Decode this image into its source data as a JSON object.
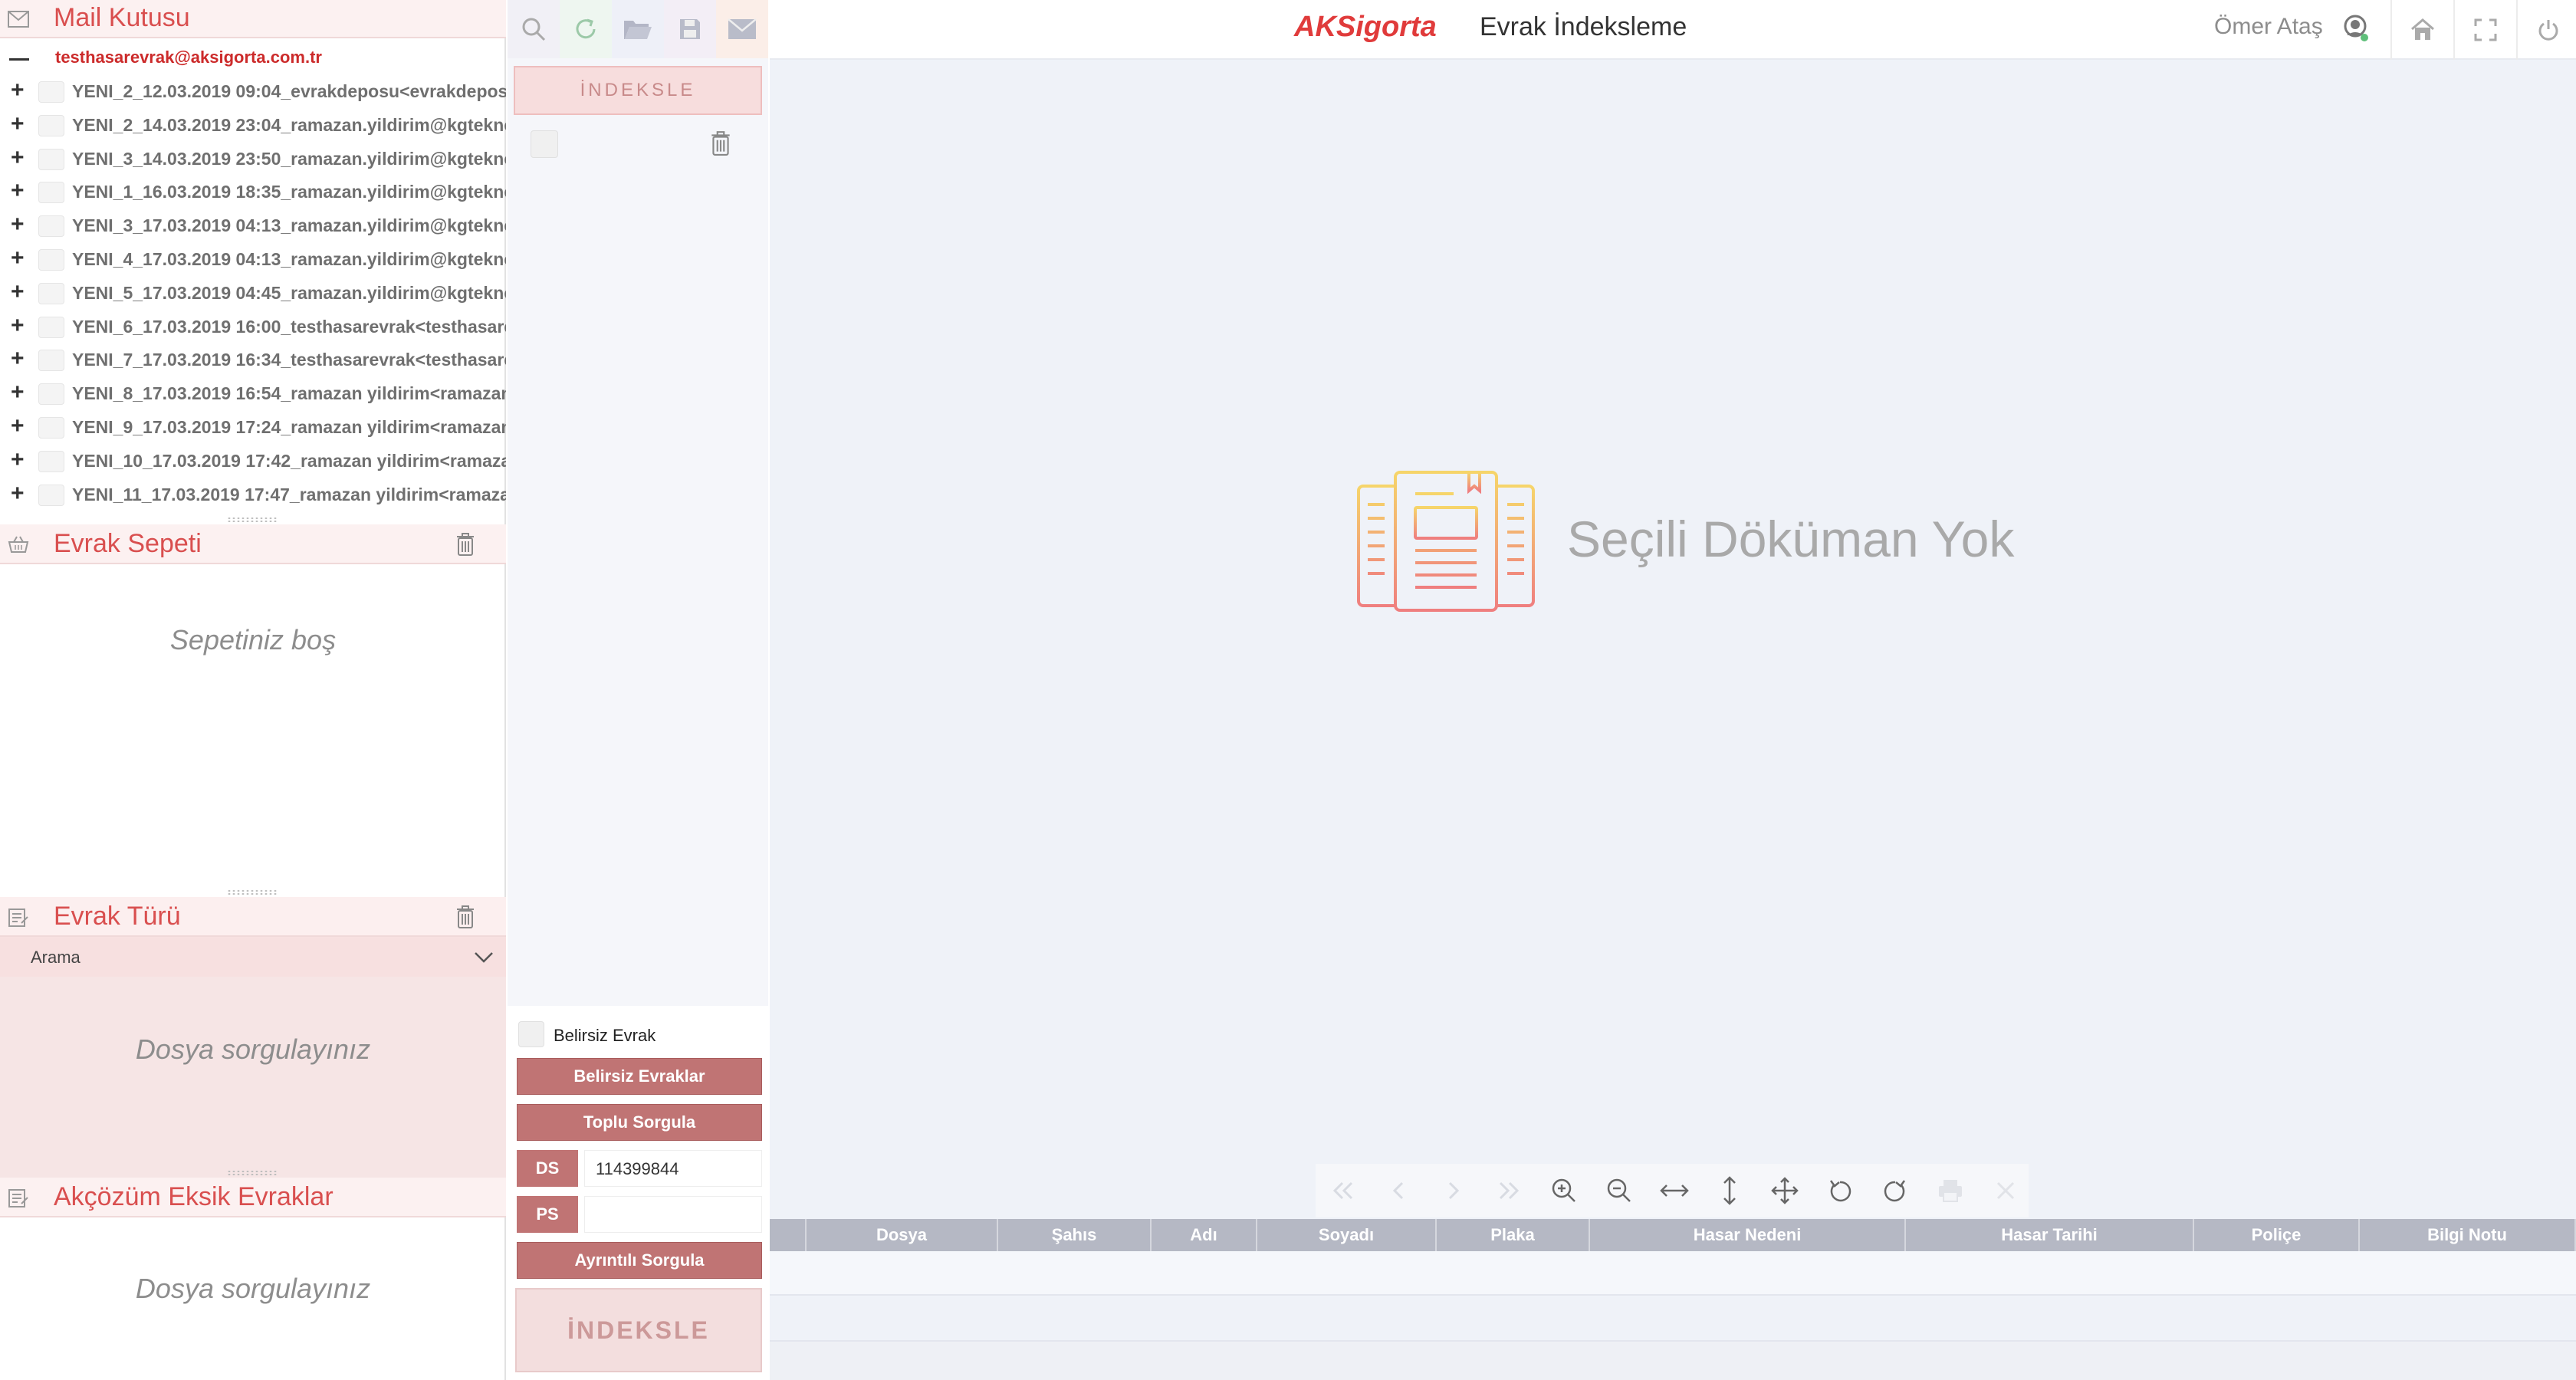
{
  "app": {
    "brand": "AKSigorta",
    "title": "Evrak İndeksleme",
    "user": "Ömer Ataş"
  },
  "mailbox": {
    "title": "Mail Kutusu",
    "account": "testhasarevrak@aksigorta.com.tr",
    "items": [
      "YENI_2_12.03.2019 09:04_evrakdeposu<evrakdeposu",
      "YENI_2_14.03.2019 23:04_ramazan.yildirim@kgtekno",
      "YENI_3_14.03.2019 23:50_ramazan.yildirim@kgtekno",
      "YENI_1_16.03.2019 18:35_ramazan.yildirim@kgtekno",
      "YENI_3_17.03.2019 04:13_ramazan.yildirim@kgtekno",
      "YENI_4_17.03.2019 04:13_ramazan.yildirim@kgtekno",
      "YENI_5_17.03.2019 04:45_ramazan.yildirim@kgtekno",
      "YENI_6_17.03.2019 16:00_testhasarevrak<testhasare",
      "YENI_7_17.03.2019 16:34_testhasarevrak<testhasare",
      "YENI_8_17.03.2019 16:54_ramazan yildirim<ramazan",
      "YENI_9_17.03.2019 17:24_ramazan yildirim<ramazan",
      "YENI_10_17.03.2019 17:42_ramazan yildirim<ramaza",
      "YENI_11_17.03.2019 17:47_ramazan yildirim<ramaza"
    ]
  },
  "basket": {
    "title": "Evrak Sepeti",
    "empty": "Sepetiniz boş"
  },
  "doc_type": {
    "title": "Evrak Türü",
    "search_label": "Arama",
    "empty": "Dosya sorgulayınız"
  },
  "missing": {
    "title": "Akçözüm Eksik Evraklar",
    "empty": "Dosya sorgulayınız"
  },
  "middle": {
    "index_top": "İNDEKSLE",
    "unknown_doc": "Belirsiz Evrak",
    "btn_unknown": "Belirsiz Evraklar",
    "btn_bulk": "Toplu Sorgula",
    "ds_label": "DS",
    "ds_value": "114399844",
    "ps_label": "PS",
    "ps_value": "",
    "btn_detail": "Ayrıntılı Sorgula",
    "index_bottom": "İNDEKSLE"
  },
  "viewer": {
    "empty": "Seçili Döküman Yok"
  },
  "grid": {
    "columns": [
      "",
      "Dosya",
      "Şahıs",
      "Adı",
      "Soyadı",
      "Plaka",
      "Hasar Nedeni",
      "Hasar Tarihi",
      "Poliçe",
      "Bilgi Notu"
    ]
  },
  "colors": {
    "accent": "#d94f4f",
    "button": "#c07474",
    "viewer_bg": "#eff2f8"
  }
}
